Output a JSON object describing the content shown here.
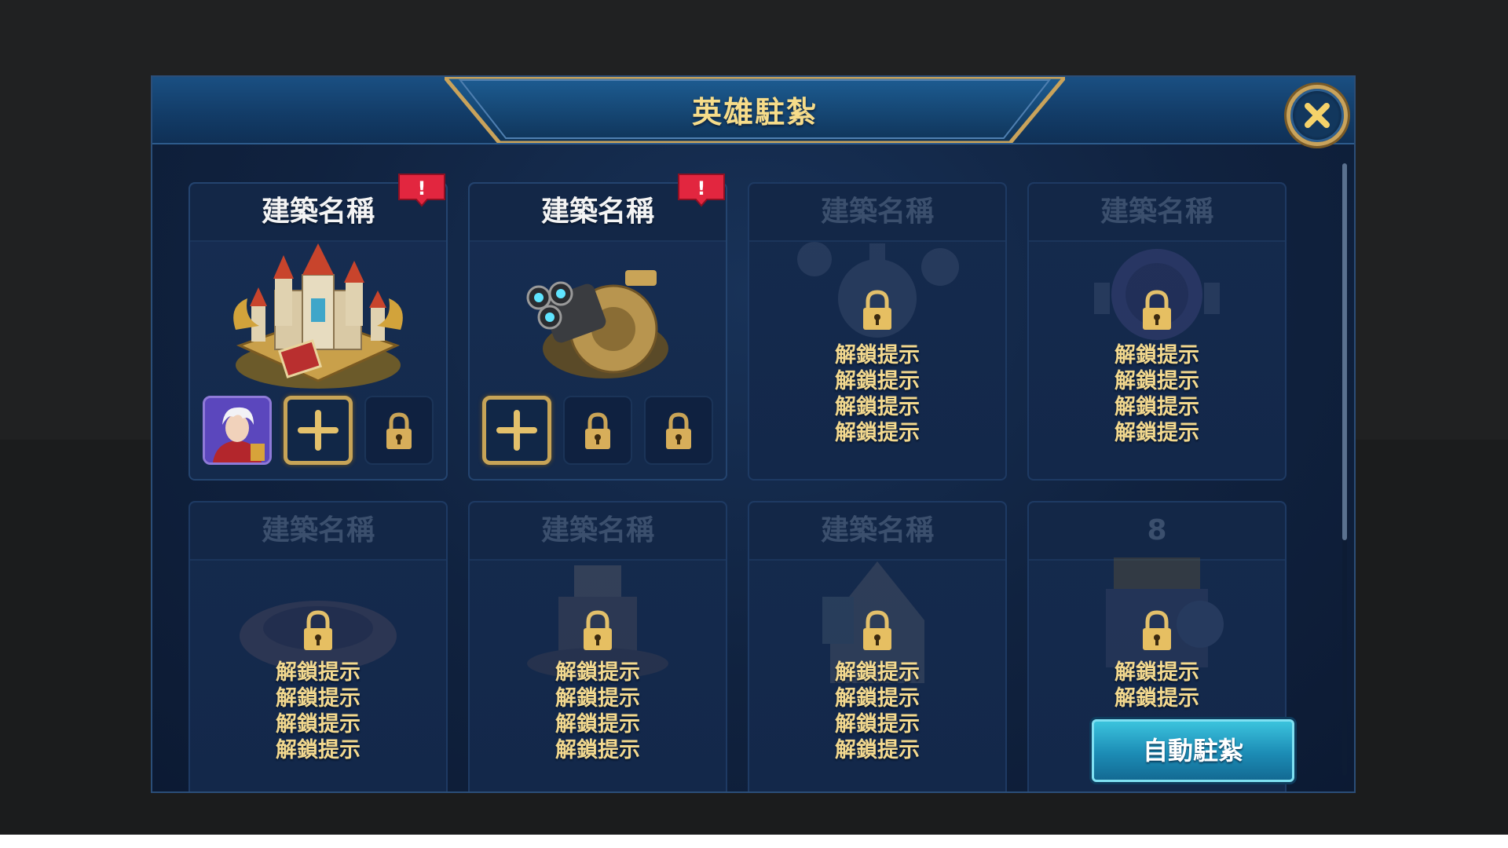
{
  "header": {
    "title": "英雄駐紮"
  },
  "cards": [
    {
      "name": "建築名稱",
      "state": "active",
      "alert": "!"
    },
    {
      "name": "建築名稱",
      "state": "active",
      "alert": "!"
    },
    {
      "name": "建築名稱",
      "state": "locked",
      "hints": [
        "解鎖提示",
        "解鎖提示",
        "解鎖提示",
        "解鎖提示"
      ]
    },
    {
      "name": "建築名稱",
      "state": "locked",
      "hints": [
        "解鎖提示",
        "解鎖提示",
        "解鎖提示",
        "解鎖提示"
      ]
    },
    {
      "name": "建築名稱",
      "state": "locked",
      "hints": [
        "解鎖提示",
        "解鎖提示",
        "解鎖提示",
        "解鎖提示"
      ]
    },
    {
      "name": "建築名稱",
      "state": "locked",
      "hints": [
        "解鎖提示",
        "解鎖提示",
        "解鎖提示",
        "解鎖提示"
      ]
    },
    {
      "name": "建築名稱",
      "state": "locked",
      "hints": [
        "解鎖提示",
        "解鎖提示",
        "解鎖提示",
        "解鎖提示"
      ]
    },
    {
      "name": "8",
      "state": "locked",
      "hints": [
        "解鎖提示",
        "解鎖提示"
      ]
    }
  ],
  "slots": {
    "card1": [
      "hero-portrait",
      "add",
      "locked"
    ],
    "card2": [
      "add",
      "locked",
      "locked"
    ]
  },
  "footer": {
    "auto_button_label": "自動駐紮"
  },
  "colors": {
    "title_gold": "#f6dc8a",
    "hint_gold": "#f3d98f",
    "alert_red": "#e2263f",
    "button_cyan": "#1c8cb5",
    "frame_gold": "#c7a457"
  },
  "icons": {
    "close": "close-x-icon",
    "lock": "padlock-icon",
    "add": "plus-icon",
    "alert": "exclamation-icon"
  }
}
